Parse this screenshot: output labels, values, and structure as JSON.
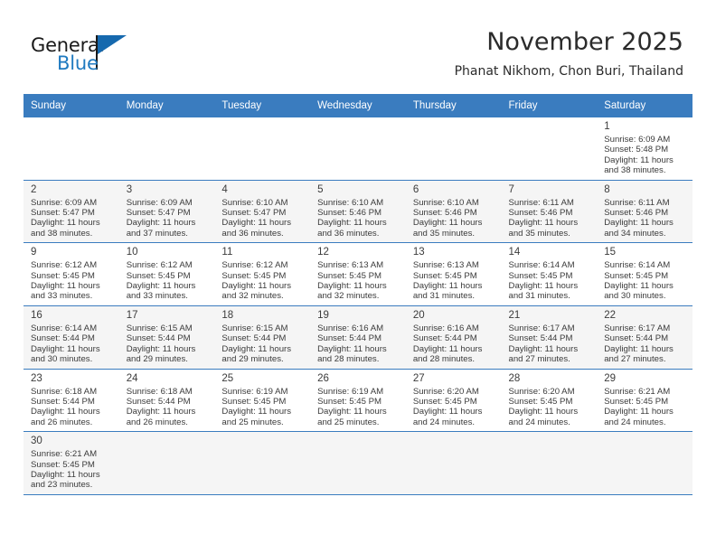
{
  "brand": {
    "name_top": "General",
    "name_bottom": "Blue",
    "flag_icon": "blue-flag-triangle",
    "color_top": "#1a1a1a",
    "color_bottom": "#1f7ac0"
  },
  "header": {
    "title": "November 2025",
    "subtitle": "Phanat Nikhom, Chon Buri, Thailand"
  },
  "theme": {
    "header_bg": "#3a7cbf",
    "header_text": "#ffffff",
    "row_alt_bg": "#f5f5f5",
    "grid_line": "#3a7cbf",
    "text": "#3b3b3b"
  },
  "weekdays": [
    "Sunday",
    "Monday",
    "Tuesday",
    "Wednesday",
    "Thursday",
    "Friday",
    "Saturday"
  ],
  "labels": {
    "sunrise": "Sunrise:",
    "sunset": "Sunset:",
    "daylight": "Daylight:"
  },
  "weeks": [
    [
      {
        "day": "",
        "lines": []
      },
      {
        "day": "",
        "lines": []
      },
      {
        "day": "",
        "lines": []
      },
      {
        "day": "",
        "lines": []
      },
      {
        "day": "",
        "lines": []
      },
      {
        "day": "",
        "lines": []
      },
      {
        "day": "1",
        "lines": [
          "Sunrise: 6:09 AM",
          "Sunset: 5:48 PM",
          "Daylight: 11 hours",
          "and 38 minutes."
        ]
      }
    ],
    [
      {
        "day": "2",
        "lines": [
          "Sunrise: 6:09 AM",
          "Sunset: 5:47 PM",
          "Daylight: 11 hours",
          "and 38 minutes."
        ]
      },
      {
        "day": "3",
        "lines": [
          "Sunrise: 6:09 AM",
          "Sunset: 5:47 PM",
          "Daylight: 11 hours",
          "and 37 minutes."
        ]
      },
      {
        "day": "4",
        "lines": [
          "Sunrise: 6:10 AM",
          "Sunset: 5:47 PM",
          "Daylight: 11 hours",
          "and 36 minutes."
        ]
      },
      {
        "day": "5",
        "lines": [
          "Sunrise: 6:10 AM",
          "Sunset: 5:46 PM",
          "Daylight: 11 hours",
          "and 36 minutes."
        ]
      },
      {
        "day": "6",
        "lines": [
          "Sunrise: 6:10 AM",
          "Sunset: 5:46 PM",
          "Daylight: 11 hours",
          "and 35 minutes."
        ]
      },
      {
        "day": "7",
        "lines": [
          "Sunrise: 6:11 AM",
          "Sunset: 5:46 PM",
          "Daylight: 11 hours",
          "and 35 minutes."
        ]
      },
      {
        "day": "8",
        "lines": [
          "Sunrise: 6:11 AM",
          "Sunset: 5:46 PM",
          "Daylight: 11 hours",
          "and 34 minutes."
        ]
      }
    ],
    [
      {
        "day": "9",
        "lines": [
          "Sunrise: 6:12 AM",
          "Sunset: 5:45 PM",
          "Daylight: 11 hours",
          "and 33 minutes."
        ]
      },
      {
        "day": "10",
        "lines": [
          "Sunrise: 6:12 AM",
          "Sunset: 5:45 PM",
          "Daylight: 11 hours",
          "and 33 minutes."
        ]
      },
      {
        "day": "11",
        "lines": [
          "Sunrise: 6:12 AM",
          "Sunset: 5:45 PM",
          "Daylight: 11 hours",
          "and 32 minutes."
        ]
      },
      {
        "day": "12",
        "lines": [
          "Sunrise: 6:13 AM",
          "Sunset: 5:45 PM",
          "Daylight: 11 hours",
          "and 32 minutes."
        ]
      },
      {
        "day": "13",
        "lines": [
          "Sunrise: 6:13 AM",
          "Sunset: 5:45 PM",
          "Daylight: 11 hours",
          "and 31 minutes."
        ]
      },
      {
        "day": "14",
        "lines": [
          "Sunrise: 6:14 AM",
          "Sunset: 5:45 PM",
          "Daylight: 11 hours",
          "and 31 minutes."
        ]
      },
      {
        "day": "15",
        "lines": [
          "Sunrise: 6:14 AM",
          "Sunset: 5:45 PM",
          "Daylight: 11 hours",
          "and 30 minutes."
        ]
      }
    ],
    [
      {
        "day": "16",
        "lines": [
          "Sunrise: 6:14 AM",
          "Sunset: 5:44 PM",
          "Daylight: 11 hours",
          "and 30 minutes."
        ]
      },
      {
        "day": "17",
        "lines": [
          "Sunrise: 6:15 AM",
          "Sunset: 5:44 PM",
          "Daylight: 11 hours",
          "and 29 minutes."
        ]
      },
      {
        "day": "18",
        "lines": [
          "Sunrise: 6:15 AM",
          "Sunset: 5:44 PM",
          "Daylight: 11 hours",
          "and 29 minutes."
        ]
      },
      {
        "day": "19",
        "lines": [
          "Sunrise: 6:16 AM",
          "Sunset: 5:44 PM",
          "Daylight: 11 hours",
          "and 28 minutes."
        ]
      },
      {
        "day": "20",
        "lines": [
          "Sunrise: 6:16 AM",
          "Sunset: 5:44 PM",
          "Daylight: 11 hours",
          "and 28 minutes."
        ]
      },
      {
        "day": "21",
        "lines": [
          "Sunrise: 6:17 AM",
          "Sunset: 5:44 PM",
          "Daylight: 11 hours",
          "and 27 minutes."
        ]
      },
      {
        "day": "22",
        "lines": [
          "Sunrise: 6:17 AM",
          "Sunset: 5:44 PM",
          "Daylight: 11 hours",
          "and 27 minutes."
        ]
      }
    ],
    [
      {
        "day": "23",
        "lines": [
          "Sunrise: 6:18 AM",
          "Sunset: 5:44 PM",
          "Daylight: 11 hours",
          "and 26 minutes."
        ]
      },
      {
        "day": "24",
        "lines": [
          "Sunrise: 6:18 AM",
          "Sunset: 5:44 PM",
          "Daylight: 11 hours",
          "and 26 minutes."
        ]
      },
      {
        "day": "25",
        "lines": [
          "Sunrise: 6:19 AM",
          "Sunset: 5:45 PM",
          "Daylight: 11 hours",
          "and 25 minutes."
        ]
      },
      {
        "day": "26",
        "lines": [
          "Sunrise: 6:19 AM",
          "Sunset: 5:45 PM",
          "Daylight: 11 hours",
          "and 25 minutes."
        ]
      },
      {
        "day": "27",
        "lines": [
          "Sunrise: 6:20 AM",
          "Sunset: 5:45 PM",
          "Daylight: 11 hours",
          "and 24 minutes."
        ]
      },
      {
        "day": "28",
        "lines": [
          "Sunrise: 6:20 AM",
          "Sunset: 5:45 PM",
          "Daylight: 11 hours",
          "and 24 minutes."
        ]
      },
      {
        "day": "29",
        "lines": [
          "Sunrise: 6:21 AM",
          "Sunset: 5:45 PM",
          "Daylight: 11 hours",
          "and 24 minutes."
        ]
      }
    ],
    [
      {
        "day": "30",
        "lines": [
          "Sunrise: 6:21 AM",
          "Sunset: 5:45 PM",
          "Daylight: 11 hours",
          "and 23 minutes."
        ]
      },
      {
        "day": "",
        "lines": []
      },
      {
        "day": "",
        "lines": []
      },
      {
        "day": "",
        "lines": []
      },
      {
        "day": "",
        "lines": []
      },
      {
        "day": "",
        "lines": []
      },
      {
        "day": "",
        "lines": []
      }
    ]
  ]
}
